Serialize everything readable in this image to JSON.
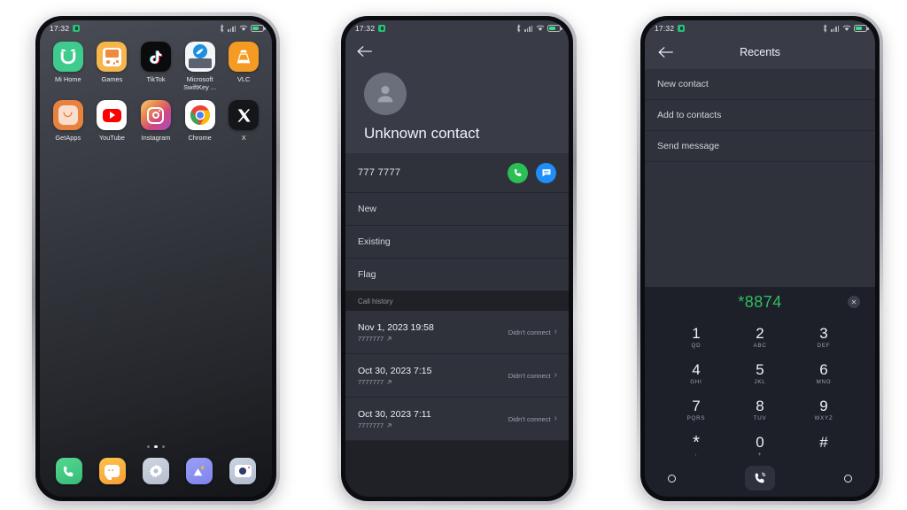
{
  "statusbar": {
    "time": "17:32",
    "icons": [
      "notification-badge-icon",
      "bluetooth-icon",
      "signal-icon",
      "wifi-icon",
      "battery-icon"
    ]
  },
  "phone1": {
    "name": "home-screen",
    "apps_row1": [
      {
        "label": "Mi Home",
        "icon": "mi-home-icon"
      },
      {
        "label": "Games",
        "icon": "games-icon"
      },
      {
        "label": "TikTok",
        "icon": "tiktok-icon"
      },
      {
        "label": "Microsoft SwiftKey ...",
        "icon": "microsoft-swiftkey-icon"
      },
      {
        "label": "VLC",
        "icon": "vlc-icon"
      }
    ],
    "apps_row2": [
      {
        "label": "GetApps",
        "icon": "getapps-icon"
      },
      {
        "label": "YouTube",
        "icon": "youtube-icon"
      },
      {
        "label": "Instagram",
        "icon": "instagram-icon"
      },
      {
        "label": "Chrome",
        "icon": "chrome-icon"
      },
      {
        "label": "X",
        "icon": "x-icon"
      }
    ],
    "dock": [
      {
        "icon": "phone-icon"
      },
      {
        "icon": "messages-icon"
      },
      {
        "icon": "settings-icon"
      },
      {
        "icon": "gallery-icon"
      },
      {
        "icon": "camera-icon"
      }
    ],
    "page_dots": {
      "count": 3,
      "active": 1
    }
  },
  "phone2": {
    "name": "contact-details-screen",
    "back_icon": "back-arrow-icon",
    "avatar_icon": "person-avatar-icon",
    "contact_name": "Unknown contact",
    "phone_number": "777 7777",
    "call_icon": "call-icon",
    "message_icon": "message-icon",
    "menu_items": [
      "New",
      "Existing",
      "Flag"
    ],
    "call_history_label": "Call history",
    "call_history": [
      {
        "date": "Nov 1, 2023 19:58",
        "number": "7777777",
        "status": "Didn't connect",
        "direction_icon": "outgoing-call-icon"
      },
      {
        "date": "Oct 30, 2023 7:15",
        "number": "7777777",
        "status": "Didn't connect",
        "direction_icon": "outgoing-call-icon"
      },
      {
        "date": "Oct 30, 2023 7:11",
        "number": "7777777",
        "status": "Didn't connect",
        "direction_icon": "outgoing-call-icon"
      }
    ]
  },
  "phone3": {
    "name": "dialer-screen",
    "back_icon": "back-arrow-icon",
    "title": "Recents",
    "options": [
      "New contact",
      "Add to contacts",
      "Send message"
    ],
    "dialed_number": "*8874",
    "dialed_number_color": "#2fbd5f",
    "clear_icon": "clear-backspace-icon",
    "keys": [
      {
        "digit": "1",
        "sub": "QD"
      },
      {
        "digit": "2",
        "sub": "ABC"
      },
      {
        "digit": "3",
        "sub": "DEF"
      },
      {
        "digit": "4",
        "sub": "GHI"
      },
      {
        "digit": "5",
        "sub": "JKL"
      },
      {
        "digit": "6",
        "sub": "MNO"
      },
      {
        "digit": "7",
        "sub": "PQRS"
      },
      {
        "digit": "8",
        "sub": "TUV"
      },
      {
        "digit": "9",
        "sub": "WXYZ"
      },
      {
        "digit": "*",
        "sub": ","
      },
      {
        "digit": "0",
        "sub": "+"
      },
      {
        "digit": "#",
        "sub": ""
      }
    ],
    "navbar": {
      "left_icon": "nav-circle-left-icon",
      "call_icon": "dial-call-icon",
      "right_icon": "nav-circle-right-icon"
    }
  }
}
